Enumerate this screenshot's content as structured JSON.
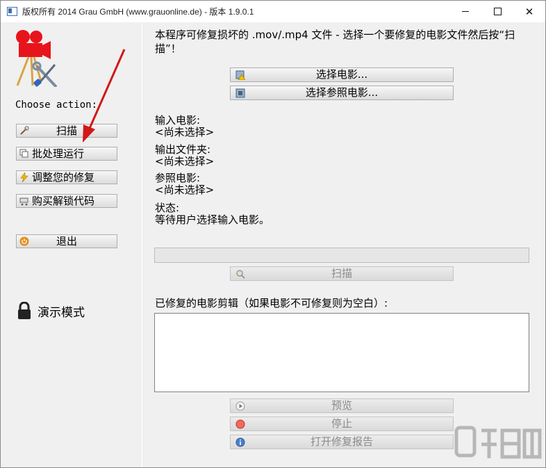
{
  "window": {
    "title": "版权所有 2014 Grau GmbH (www.grauonline.de) - 版本 1.9.0.1",
    "controls": {
      "minimize": "",
      "maximize": "",
      "close": "✕"
    }
  },
  "sidebar": {
    "choose_label": "Choose action:",
    "buttons": [
      {
        "label": "扫描",
        "icon": "wrench-icon"
      },
      {
        "label": "批处理运行",
        "icon": "batch-icon"
      },
      {
        "label": "调整您的修复",
        "icon": "lightning-icon"
      },
      {
        "label": "购买解锁代码",
        "icon": "cart-icon"
      },
      {
        "label": "退出",
        "icon": "power-icon"
      }
    ],
    "demo_mode": "演示模式"
  },
  "main": {
    "intro": "本程序可修复损坏的 .mov/.mp4 文件 - 选择一个要修复的电影文件然后按“扫描”！",
    "select_movie": "选择电影...",
    "select_reference": "选择参照电影...",
    "input_movie_label": "输入电影:",
    "input_movie_value": "<尚未选择>",
    "output_folder_label": "输出文件夹:",
    "output_folder_value": "<尚未选择>",
    "reference_label": "参照电影:",
    "reference_value": "<尚未选择>",
    "status_label": "状态:",
    "status_value": "等待用户选择输入电影。",
    "scan_button": "扫描",
    "progress": 0,
    "clips_label": "已修复的电影剪辑（如果电影不可修复则为空白）:",
    "preview_button": "预览",
    "stop_button": "停止",
    "report_button": "打开修复报告"
  },
  "colors": {
    "arrow": "#d01818",
    "camera": "#e8141b",
    "disabled_text": "#8a8a8a"
  }
}
